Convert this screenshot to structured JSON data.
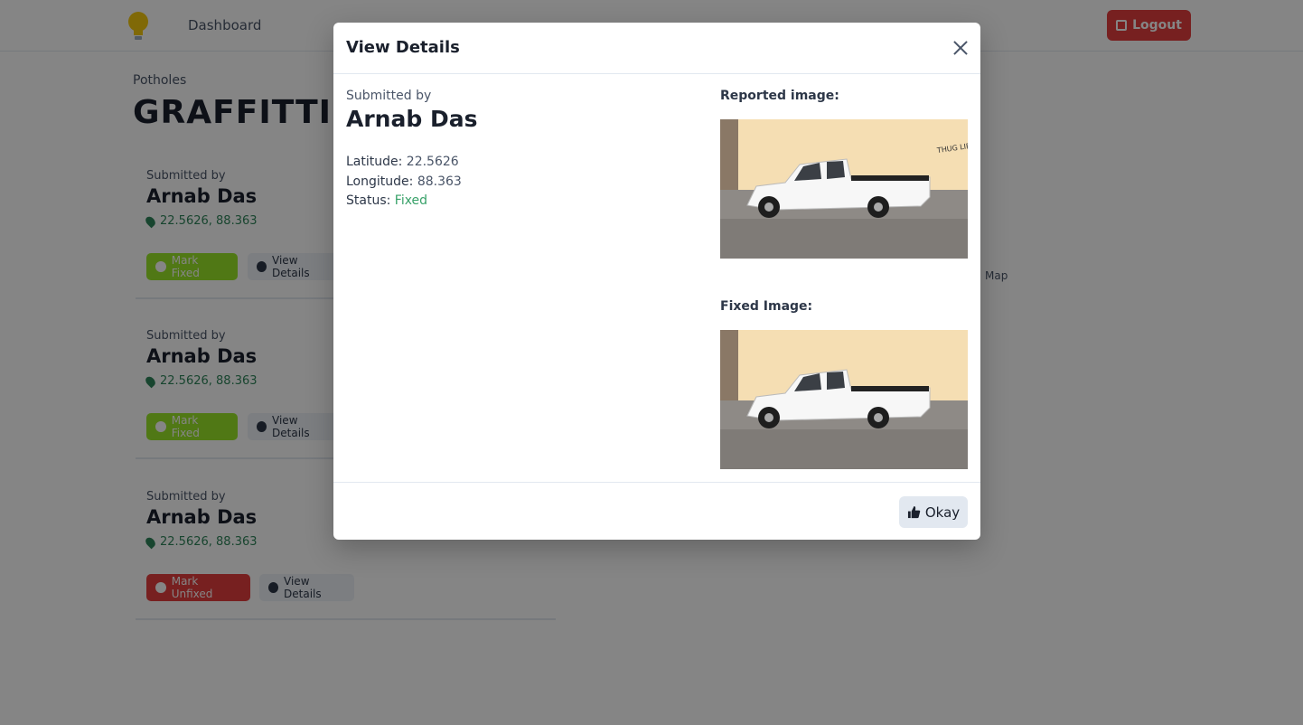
{
  "navbar": {
    "dashboard_label": "Dashboard",
    "logout_label": "Logout"
  },
  "page": {
    "section_label": "Potholes",
    "section_title": "GRAFFITTI",
    "map_label": "Map"
  },
  "cards": [
    {
      "submitted_label": "Submitted by",
      "name": "Arnab Das",
      "coords": "22.5626, 88.363",
      "action_label": "Mark Fixed",
      "view_label": "View Details"
    },
    {
      "submitted_label": "Submitted by",
      "name": "Arnab Das",
      "coords": "22.5626, 88.363",
      "action_label": "Mark Fixed",
      "view_label": "View Details"
    },
    {
      "submitted_label": "Submitted by",
      "name": "Arnab Das",
      "coords": "22.5626, 88.363",
      "action_label": "Mark Unfixed",
      "view_label": "View Details"
    }
  ],
  "modal": {
    "title": "View Details",
    "submitted_label": "Submitted by",
    "submitter_name": "Arnab Das",
    "latitude_label": "Latitude:",
    "latitude_value": "22.5626",
    "longitude_label": "Longitude:",
    "longitude_value": "88.363",
    "status_label": "Status:",
    "status_value": "Fixed",
    "reported_image_label": "Reported image:",
    "fixed_image_label": "Fixed Image:",
    "okay_label": "Okay",
    "graffiti_text": "THUG LIFE"
  },
  "colors": {
    "status_fixed": "#38a169",
    "logout_bg": "#e53e3e",
    "mark_fixed_bg": "#9ae629"
  },
  "icons": {
    "close": "close-icon",
    "okay": "thumbs-up-icon",
    "logout": "logout-icon",
    "location": "map-pin-icon"
  }
}
